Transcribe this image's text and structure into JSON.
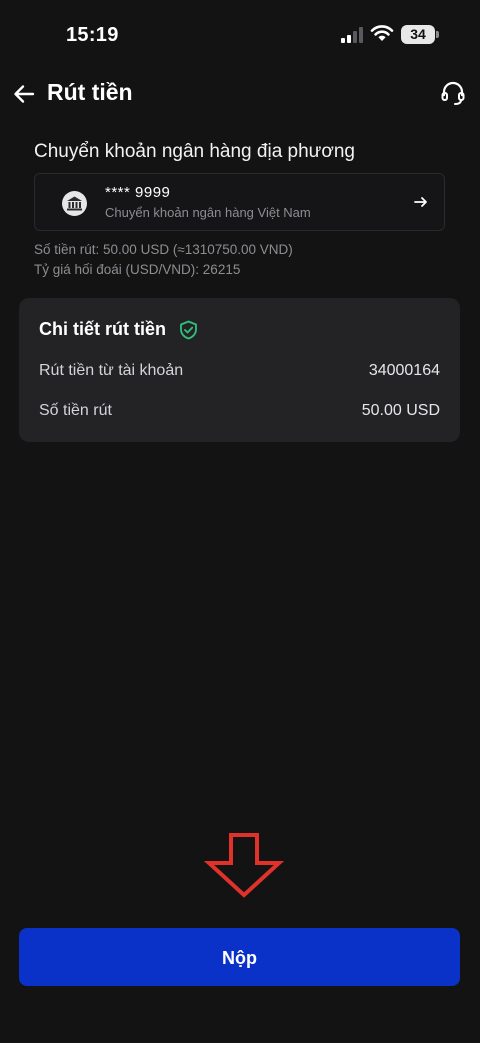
{
  "status_bar": {
    "time": "15:19",
    "battery": "34"
  },
  "header": {
    "title": "Rút tiền",
    "back_icon": "arrow-left-icon",
    "support_icon": "headset-icon"
  },
  "withdraw_method": {
    "section_title": "Chuyển khoản ngân hàng địa phương",
    "account_number": "**** 9999",
    "bank_name": "Chuyển khoản ngân hàng Việt Nam",
    "bank_icon": "bank-building-icon",
    "arrow_icon": "arrow-right-icon"
  },
  "info": {
    "amount_line": "Số tiền rút: 50.00 USD (≈1310750.00 VND)",
    "rate_line": "Tỷ giá hối đoái (USD/VND): 26215"
  },
  "details": {
    "title": "Chi tiết rút tiền",
    "shield_icon": "shield-check-icon",
    "rows": [
      {
        "label": "Rút tiền từ tài khoản",
        "value": "34000164"
      },
      {
        "label": "Số tiền rút",
        "value": "50.00 USD"
      }
    ]
  },
  "annotation": {
    "icon": "down-arrow-outline-icon",
    "color": "#e0322b"
  },
  "submit": {
    "label": "Nộp",
    "color": "#0a32c8"
  }
}
